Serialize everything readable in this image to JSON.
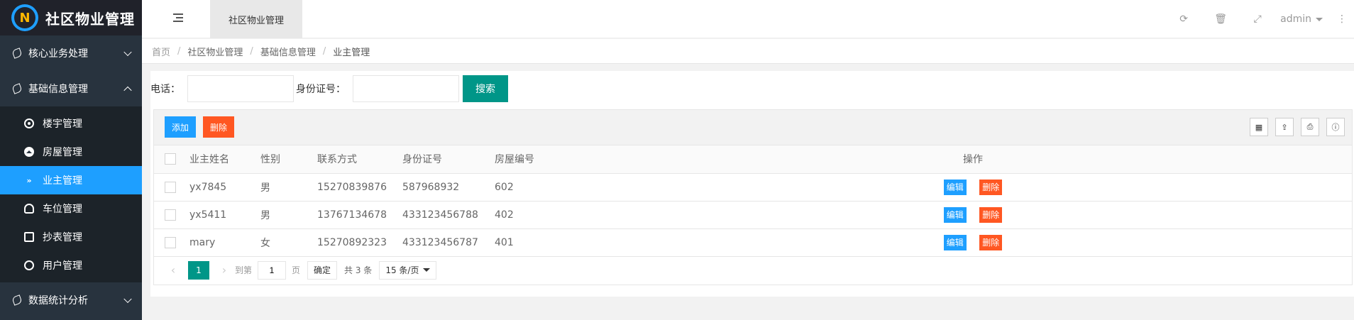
{
  "app": {
    "logo_letter": "N",
    "title": "社区物业管理"
  },
  "sidebar": {
    "groups": [
      {
        "label": "核心业务处理"
      },
      {
        "label": "基础信息管理"
      },
      {
        "label": "数据统计分析"
      }
    ],
    "items": [
      {
        "label": "楼宇管理",
        "icon": "target-icon"
      },
      {
        "label": "房屋管理",
        "icon": "house-icon"
      },
      {
        "label": "业主管理",
        "icon": "double-chevron-icon"
      },
      {
        "label": "车位管理",
        "icon": "gauge-icon"
      },
      {
        "label": "抄表管理",
        "icon": "edit-icon"
      },
      {
        "label": "用户管理",
        "icon": "user-icon"
      }
    ]
  },
  "header": {
    "tab": "社区物业管理",
    "user": "admin"
  },
  "breadcrumb": [
    "首页",
    "社区物业管理",
    "基础信息管理",
    "业主管理"
  ],
  "search": {
    "phone_label": "电话：",
    "phone_value": "",
    "id_label": "身份证号：",
    "id_value": "",
    "button": "搜索"
  },
  "toolbar": {
    "add": "添加",
    "delete": "删除"
  },
  "table": {
    "headers": [
      "业主姓名",
      "性别",
      "联系方式",
      "身份证号",
      "房屋编号",
      "操作"
    ],
    "rows": [
      {
        "name": "yx7845",
        "gender": "男",
        "phone": "15270839876",
        "id_card": "587968932",
        "house": "602"
      },
      {
        "name": "yx5411",
        "gender": "男",
        "phone": "13767134678",
        "id_card": "433123456788",
        "house": "402"
      },
      {
        "name": "mary",
        "gender": "女",
        "phone": "15270892323",
        "id_card": "433123456787",
        "house": "401"
      }
    ],
    "edit_label": "编辑",
    "remove_label": "删除"
  },
  "pagination": {
    "current": "1",
    "goto_label": "到第",
    "goto_value": "1",
    "page_unit": "页",
    "confirm": "确定",
    "total": "共 3 条",
    "per_page": "15 条/页"
  }
}
